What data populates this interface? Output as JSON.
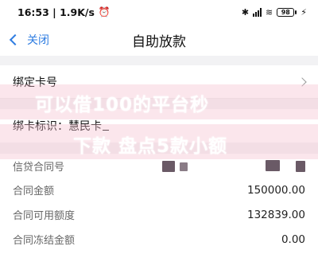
{
  "status_bar": {
    "time": "16:53",
    "speed": "1.9K/s",
    "battery": "98",
    "icons": [
      "alarm-icon",
      "bluetooth-icon",
      "hd-signal-icon",
      "wifi-icon",
      "charging-icon"
    ]
  },
  "nav": {
    "back_label": "关闭",
    "title": "自助放款"
  },
  "card": {
    "bind_label": "绑定卡号",
    "id_label": "绑卡标识：",
    "id_value": "慧民卡"
  },
  "contract": {
    "rows": [
      {
        "label": "信贷合同号",
        "value": ""
      },
      {
        "label": "合同金额",
        "value": "150000.00"
      },
      {
        "label": "合同可用额度",
        "value": "132839.00"
      },
      {
        "label": "合同冻结金额",
        "value": "0.00"
      }
    ]
  },
  "watermark": {
    "line1": "可以借100的平台秒",
    "line2": "下款 盘点5款小额"
  },
  "colors": {
    "accent": "#2f7de1",
    "page_bg": "#f2f2f4",
    "watermark_band": "#f5becd"
  }
}
